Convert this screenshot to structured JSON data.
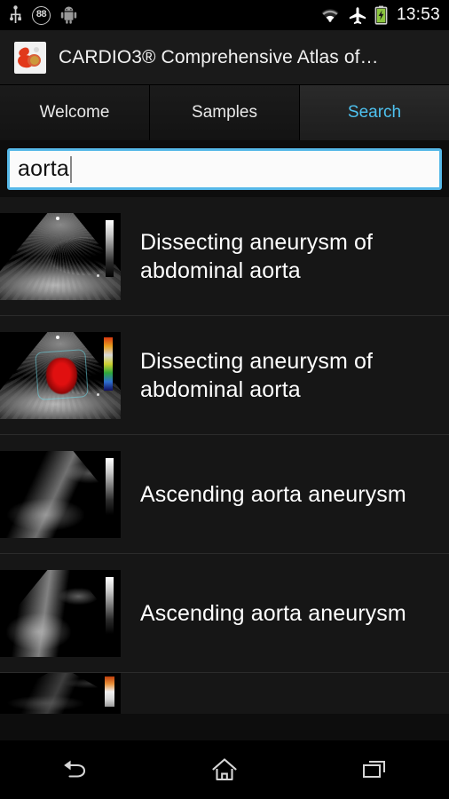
{
  "statusbar": {
    "left_icons": [
      "usb-icon",
      "counter-badge-88",
      "android-robot-icon"
    ],
    "counter_badge": "88",
    "right_icons": [
      "wifi-icon",
      "airplane-mode-icon",
      "battery-charging-icon"
    ],
    "time": "13:53"
  },
  "actionbar": {
    "app_icon": "cardio-atlas-app-icon",
    "title": "CARDIO3® Comprehensive Atlas of…"
  },
  "tabs": [
    {
      "label": "Welcome",
      "active": false
    },
    {
      "label": "Samples",
      "active": false
    },
    {
      "label": "Search",
      "active": true
    }
  ],
  "search": {
    "value": "aorta",
    "placeholder": ""
  },
  "results": [
    {
      "title": "Dissecting aneurysm of abdominal aorta",
      "thumb": "ultrasound-grayscale-short-axis"
    },
    {
      "title": "Dissecting aneurysm of abdominal aorta",
      "thumb": "ultrasound-color-doppler"
    },
    {
      "title": "Ascending aorta aneurysm",
      "thumb": "ultrasound-grayscale-dark"
    },
    {
      "title": "Ascending aorta aneurysm",
      "thumb": "ultrasound-grayscale-dark-2"
    },
    {
      "title": "",
      "thumb": "ultrasound-color-doppler-partial"
    }
  ],
  "navbar": {
    "back_label": "Back",
    "home_label": "Home",
    "recents_label": "Recent apps"
  },
  "colors": {
    "accent": "#4ec2f0",
    "search_border": "#56b8e8",
    "list_background": "#161616",
    "divider": "#2b2b2b",
    "battery_green": "#8cc63f"
  }
}
